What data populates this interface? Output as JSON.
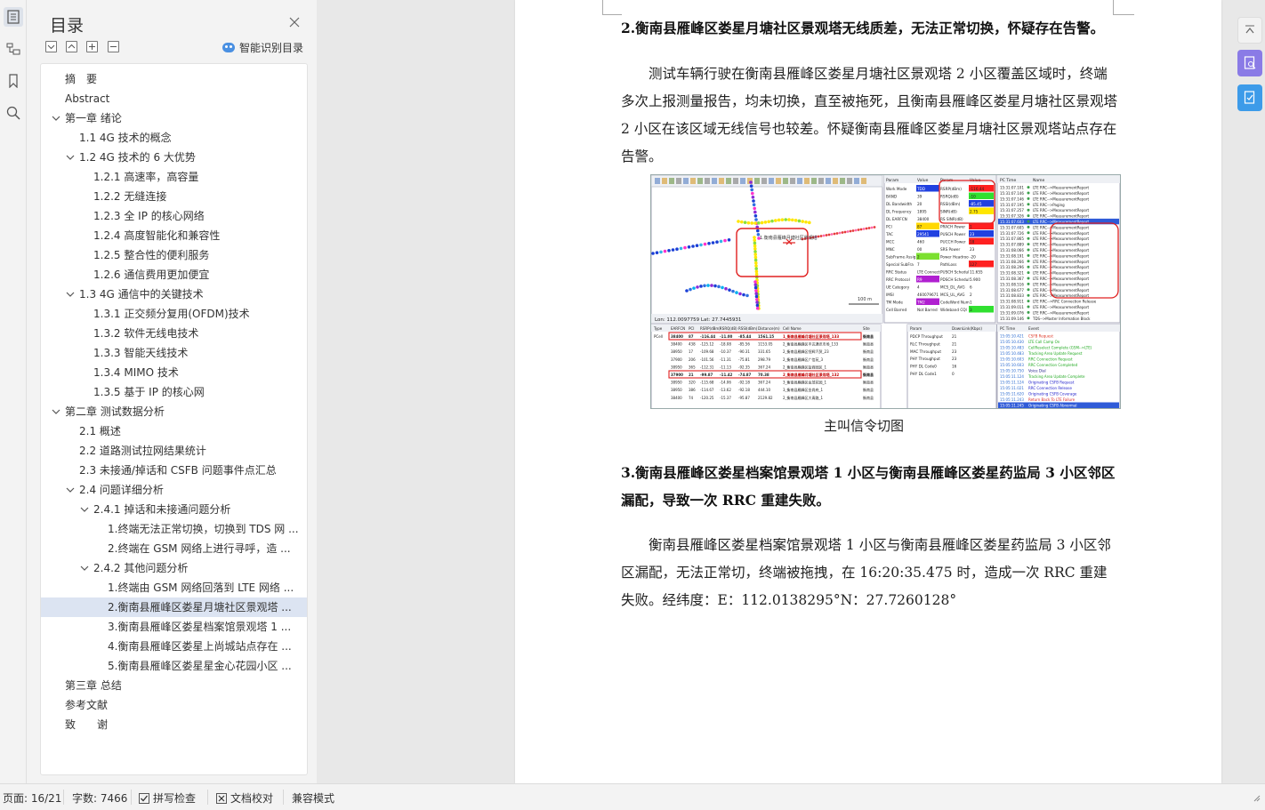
{
  "toc_panel": {
    "title": "目录",
    "smart_toc_label": "智能识别目录",
    "items": [
      {
        "level": 0,
        "label": "摘　要",
        "caret": ""
      },
      {
        "level": 0,
        "label": "Abstract",
        "caret": ""
      },
      {
        "level": 0,
        "label": "第一章  绪论",
        "caret": "open"
      },
      {
        "level": 1,
        "label": "1.1 4G 技术的概念",
        "caret": ""
      },
      {
        "level": 1,
        "label": "1.2 4G 技术的 6 大优势",
        "caret": "open"
      },
      {
        "level": 2,
        "label": "1.2.1 高速率，高容量",
        "caret": ""
      },
      {
        "level": 2,
        "label": "1.2.2 无缝连接",
        "caret": ""
      },
      {
        "level": 2,
        "label": "1.2.3 全 IP 的核心网络",
        "caret": ""
      },
      {
        "level": 2,
        "label": "1.2.4 高度智能化和兼容性",
        "caret": ""
      },
      {
        "level": 2,
        "label": "1.2.5 整合性的便利服务",
        "caret": ""
      },
      {
        "level": 2,
        "label": "1.2.6 通信费用更加便宜",
        "caret": ""
      },
      {
        "level": 1,
        "label": "1.3 4G 通信中的关键技术",
        "caret": "open"
      },
      {
        "level": 2,
        "label": "1.3.1  正交频分复用(OFDM)技术",
        "caret": ""
      },
      {
        "level": 2,
        "label": "1.3.2  软件无线电技术",
        "caret": ""
      },
      {
        "level": 2,
        "label": "1.3.3  智能天线技术",
        "caret": ""
      },
      {
        "level": 2,
        "label": "1.3.4 MIMO 技术",
        "caret": ""
      },
      {
        "level": 2,
        "label": "1.3.5  基于 IP 的核心网",
        "caret": ""
      },
      {
        "level": 0,
        "label": "第二章  测试数据分析",
        "caret": "open"
      },
      {
        "level": 1,
        "label": "2.1 概述",
        "caret": ""
      },
      {
        "level": 1,
        "label": "2.2 道路测试拉网结果统计",
        "caret": ""
      },
      {
        "level": 1,
        "label": "2.3 未接通/掉话和 CSFB 问题事件点汇总",
        "caret": ""
      },
      {
        "level": 1,
        "label": "2.4 问题详细分析",
        "caret": "open"
      },
      {
        "level": 2,
        "label": "2.4.1 掉话和未接通问题分析",
        "caret": "open"
      },
      {
        "level": 3,
        "label": "1.终端无法正常切换，切换到 TDS 网 ...",
        "caret": ""
      },
      {
        "level": 3,
        "label": "2.终端在 GSM 网络上进行寻呼，造 ...",
        "caret": ""
      },
      {
        "level": 2,
        "label": "2.4.2 其他问题分析",
        "caret": "open"
      },
      {
        "level": 3,
        "label": "1.终端由 GSM 网络回落到 LTE 网络 ...",
        "caret": ""
      },
      {
        "level": 3,
        "label": "2.衡南县雁峰区娄星月塘社区景观塔 ...",
        "caret": "",
        "selected": true
      },
      {
        "level": 3,
        "label": "3.衡南县雁峰区娄星档案馆景观塔 1 ...",
        "caret": ""
      },
      {
        "level": 3,
        "label": "4.衡南县雁峰区娄星上尚城站点存在 ...",
        "caret": ""
      },
      {
        "level": 3,
        "label": "5.衡南县雁峰区娄星星金心花园小区 ...",
        "caret": ""
      },
      {
        "level": 0,
        "label": "第三章  总结",
        "caret": ""
      },
      {
        "level": 0,
        "label": "参考文献",
        "caret": ""
      },
      {
        "level": 0,
        "label": "致　　谢",
        "caret": ""
      }
    ]
  },
  "document": {
    "heading_1": "2.衡南县雁峰区娄星月塘社区景观塔无线质差，无法正常切换，怀疑存在告警。",
    "para_1": "测试车辆行驶在衡南县雁峰区娄星月塘社区景观塔 2 小区覆盖区域时，终端多次上报测量报告，均未切换，直至被拖死，且衡南县雁峰区娄星月塘社区景观塔 2 小区在该区域无线信号也较差。怀疑衡南县雁峰区娄星月塘社区景观塔站点存在告警。",
    "figure_caption": "主叫信令切图",
    "heading_2": "3.衡南县雁峰区娄星档案馆景观塔 1 小区与衡南县雁峰区娄星药监局 3 小区邻区漏配，导致一次 RRC 重建失败。",
    "para_2": "衡南县雁峰区娄星档案馆景观塔 1 小区与衡南县雁峰区娄星药监局 3 小区邻区漏配，无法正常切，终端被拖拽，在 16:20:35.475 时，造成一次 RRC 重建失败。经纬度：E：112.0138295°N：27.7260128°"
  },
  "figure": {
    "map_status": "Lon: 112.0097759  Lat: 27.7445931",
    "map_scale": "100 m",
    "map_label": "1.衡南县雁峰月塘社区景观塔",
    "param_headers": [
      "Param",
      "Value",
      "Param",
      "Value"
    ],
    "params_left": [
      {
        "name": "Work Mode",
        "value": "TDD"
      },
      {
        "name": "BAND",
        "value": "39"
      },
      {
        "name": "DL Bandwidth",
        "value": "20"
      },
      {
        "name": "DL Frequency",
        "value": "1895"
      },
      {
        "name": "DL EARFCN",
        "value": "38400"
      },
      {
        "name": "PCI",
        "value": "87"
      },
      {
        "name": "TAC",
        "value": "29541"
      },
      {
        "name": "MCC",
        "value": "460"
      },
      {
        "name": "MNC",
        "value": "00"
      },
      {
        "name": "SubFrame Assig",
        "value": "2"
      },
      {
        "name": "Special SubFra",
        "value": "7"
      },
      {
        "name": "RRC Status",
        "value": "LTE Connect"
      },
      {
        "name": "RRC Protocol",
        "value": "R9"
      },
      {
        "name": "UE Category",
        "value": "4"
      },
      {
        "name": "IMSI",
        "value": "460079671"
      },
      {
        "name": "TM Mode",
        "value": "TM2"
      },
      {
        "name": "Cell Barred",
        "value": "Not Barred"
      }
    ],
    "params_right": [
      {
        "name": "RSRP(dBm)",
        "value": "-116.44"
      },
      {
        "name": "RSRQ(dB)",
        "value": "-10"
      },
      {
        "name": "RSSI(dBm)",
        "value": "-85.45"
      },
      {
        "name": "SINR(dB)",
        "value": "2.75"
      },
      {
        "name": "RS SINR(dB)",
        "value": ""
      },
      {
        "name": "PRACH Power",
        "value": "1"
      },
      {
        "name": "PUSCH Power",
        "value": "23"
      },
      {
        "name": "PUCCH Power",
        "value": "18"
      },
      {
        "name": "SRS Power",
        "value": "23"
      },
      {
        "name": "Power Headroo",
        "value": "-20"
      },
      {
        "name": "PathLoss",
        "value": "127"
      },
      {
        "name": "PUSCH Schedul",
        "value": "11.655"
      },
      {
        "name": "PDSCH Schedul",
        "value": "5.900"
      },
      {
        "name": "MCS_DL_AVG",
        "value": "6"
      },
      {
        "name": "MCS_UL_AVG",
        "value": "2"
      },
      {
        "name": "CodeWord Num",
        "value": "1"
      },
      {
        "name": "Wideband CQI",
        "value": "3"
      }
    ],
    "msg_headers": [
      "PC Time",
      "Name"
    ],
    "messages": [
      {
        "time": "15:31:07.101",
        "name": "LTE RRC-->MeasurementReport"
      },
      {
        "time": "15:31:07.146",
        "name": "LTE RRC-->MeasurementReport"
      },
      {
        "time": "15:31:07.146",
        "name": "LTE RRC-->MeasurementReport"
      },
      {
        "time": "15:31:07.195",
        "name": "LTE RRC-->Paging"
      },
      {
        "time": "15:31:07.257",
        "name": "LTE RRC-->MeasurementReport"
      },
      {
        "time": "15:31:07.326",
        "name": "LTE RRC-->MeasurementReport"
      },
      {
        "time": "15:31:07.603",
        "name": "LTE RRC-->MeasurementReport",
        "selected": true
      },
      {
        "time": "15:31:07.605",
        "name": "LTE RRC-->MeasurementReport"
      },
      {
        "time": "15:31:07.726",
        "name": "LTE RRC-->MeasurementReport"
      },
      {
        "time": "15:31:07.865",
        "name": "LTE RRC-->MeasurementReport"
      },
      {
        "time": "15:31:07.889",
        "name": "LTE RRC-->MeasurementReport"
      },
      {
        "time": "15:31:08.066",
        "name": "LTE RRC-->MeasurementReport"
      },
      {
        "time": "15:31:08.191",
        "name": "LTE RRC-->MeasurementReport"
      },
      {
        "time": "15:31:08.266",
        "name": "LTE RRC-->MeasurementReport"
      },
      {
        "time": "15:31:08.296",
        "name": "LTE RRC-->MeasurementReport"
      },
      {
        "time": "15:31:08.321",
        "name": "LTE RRC-->MeasurementReport"
      },
      {
        "time": "15:31:08.367",
        "name": "LTE RRC-->MeasurementReport"
      },
      {
        "time": "15:31:08.516",
        "name": "LTE RRC-->MeasurementReport"
      },
      {
        "time": "15:31:08.677",
        "name": "LTE RRC-->MeasurementReport"
      },
      {
        "time": "15:31:08.833",
        "name": "LTE RRC-->MeasurementReport"
      },
      {
        "time": "15:31:08.911",
        "name": "LTE RRC-->RRC Connection Release"
      },
      {
        "time": "15:31:09.011",
        "name": "LTE RRC-->MeasurementReport"
      },
      {
        "time": "15:31:09.076",
        "name": "LTE RRC-->MeasurementReport"
      },
      {
        "time": "15:31:09.146",
        "name": "TDS-->Master Information Block"
      }
    ],
    "cell_headers": [
      "Type",
      "EARFCN",
      "PCI",
      "RSRP(dBm)",
      "RSRQ(dB)",
      "RSSI(dBm)",
      "Distance(m)",
      "Cell Name",
      "Site"
    ],
    "cells": [
      {
        "type": "PCell",
        "earfcn": "38400",
        "pci": "87",
        "rsrp": "-116.44",
        "rsrq": "-11.00",
        "rssi": "-85.44",
        "dist": "1561.15",
        "name": "1_衡南县雁峰月塘社区景观塔_133",
        "site": "衡南县",
        "highlight": true
      },
      {
        "type": "",
        "earfcn": "38400",
        "pci": "438",
        "rsrp": "-125.12",
        "rsrq": "-18.08",
        "rssi": "-85.56",
        "dist": "1153.05",
        "name": "2_衡南县雁峰区丰达通讯市场_133",
        "site": "衡南县"
      },
      {
        "type": "",
        "earfcn": "38950",
        "pci": "17",
        "rsrp": "-109.68",
        "rsrq": "-10.37",
        "rssi": "-90.31",
        "dist": "331.65",
        "name": "2_衡南县雁峰区恒辉汽贸_23",
        "site": "衡南县"
      },
      {
        "type": "",
        "earfcn": "37900",
        "pci": "206",
        "rsrp": "-101.56",
        "rsrq": "-11.31",
        "rssi": "-75.81",
        "dist": "298.79",
        "name": "2_衡南县雁峰区广信苑_3",
        "site": "衡南县"
      },
      {
        "type": "",
        "earfcn": "38950",
        "pci": "365",
        "rsrp": "-112.31",
        "rsrq": "-11.13",
        "rssi": "-92.35",
        "dist": "367.24",
        "name": "2_衡南县雁峰区盐商园区_1",
        "site": "衡南县"
      },
      {
        "type": "",
        "earfcn": "37900",
        "pci": "21",
        "rsrp": "-99.87",
        "rsrq": "-11.42",
        "rssi": "-74.87",
        "dist": "70.38",
        "name": "2_衡南县雁峰月塘社区景观塔_132",
        "site": "衡南县",
        "highlight": true
      },
      {
        "type": "",
        "earfcn": "38950",
        "pci": "320",
        "rsrp": "-115.68",
        "rsrq": "-14.06",
        "rssi": "-92.18",
        "dist": "367.24",
        "name": "3_衡南县雁峰区金茂花园_1",
        "site": "衡南县"
      },
      {
        "type": "",
        "earfcn": "38950",
        "pci": "386",
        "rsrp": "-114.67",
        "rsrq": "-13.62",
        "rssi": "-92.18",
        "dist": "444.10",
        "name": "3_衡南县雁峰区金尚府_1",
        "site": "衡南县"
      },
      {
        "type": "",
        "earfcn": "38400",
        "pci": "74",
        "rsrp": "-120.25",
        "rsrq": "-15.37",
        "rssi": "-95.87",
        "dist": "2129.82",
        "name": "2_衡南县雁峰区大青路_1",
        "site": "衡南县"
      }
    ],
    "tput_headers": [
      "Param",
      "DownLink(Kbps)",
      ""
    ],
    "throughput": [
      {
        "name": "PDCP Throughput",
        "value": "21"
      },
      {
        "name": "RLC Throughput",
        "value": "21"
      },
      {
        "name": "MAC Throughput",
        "value": "23"
      },
      {
        "name": "PHY Throughput",
        "value": "23"
      },
      {
        "name": "PHY DL Code0",
        "value": "16"
      },
      {
        "name": "PHY DL Code1",
        "value": "0"
      }
    ],
    "event_headers": [
      "PC Time",
      "Event"
    ],
    "events": [
      {
        "time": "15:05:10.421",
        "name": "CSFB Request"
      },
      {
        "time": "15:05:10.430",
        "name": "LTE Call Camp On"
      },
      {
        "time": "15:05:10.483",
        "name": "CellReselect Complete (GSM-->LTE)"
      },
      {
        "time": "15:05:10.483",
        "name": "Tracking Area Update Request"
      },
      {
        "time": "15:05:10.603",
        "name": "RRC Connection Request"
      },
      {
        "time": "15:05:10.603",
        "name": "RRC Connection Completed"
      },
      {
        "time": "15:05:10.750",
        "name": "Voice Dial"
      },
      {
        "time": "15:05:11.124",
        "name": "Tracking Area Update Complete"
      },
      {
        "time": "15:05:11.124",
        "name": "Originating CSFB Request"
      },
      {
        "time": "15:05:11.021",
        "name": "RRC Connection Release"
      },
      {
        "time": "15:05:11.620",
        "name": "Originating CSFB Coverage"
      },
      {
        "time": "15:05:11.243",
        "name": "Return Back To LTE Failure"
      },
      {
        "time": "15:05:11.245",
        "name": "Originating CSFB Abnormal",
        "selected": true
      }
    ]
  },
  "status_bar": {
    "page": "页面: 16/21",
    "words": "字数: 7466",
    "spell_check": "拼写检查",
    "proofread": "文档校对",
    "compat_mode": "兼容模式"
  },
  "colors": {
    "accent": "#4a7fd6",
    "selected_toc": "#dce4f2",
    "highlight_red": "#e02020"
  }
}
